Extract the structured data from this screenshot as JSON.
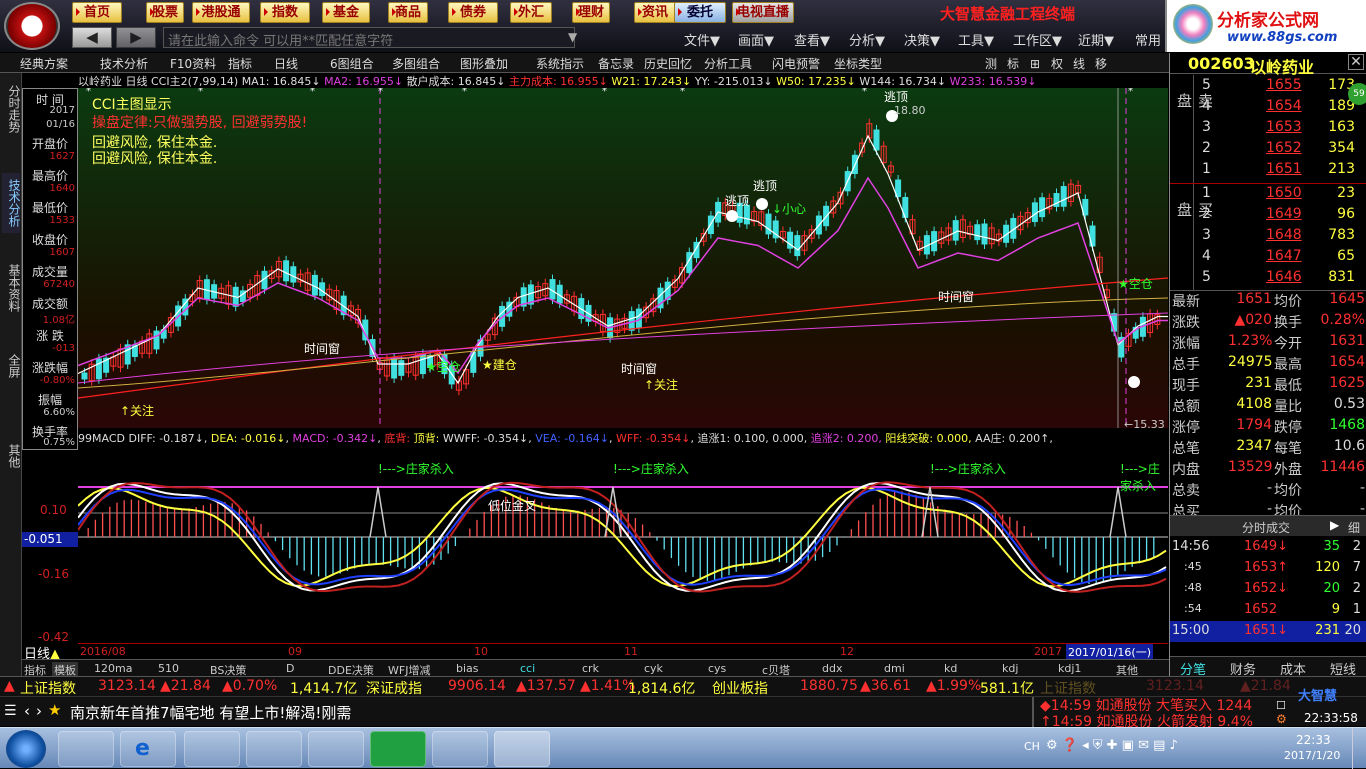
{
  "nav": {
    "buttons": [
      "首页",
      "股票",
      "港股通",
      "指数",
      "基金",
      "商品",
      "债券",
      "外汇",
      "理财",
      "资讯",
      "委托",
      "电视直播"
    ]
  },
  "brand": {
    "title": "大智慧金融工程终端",
    "site_name": "分析家公式网",
    "site_url": "www.88gs.com"
  },
  "command": {
    "placeholder": "请在此输入命令   可以用**匹配任意字符"
  },
  "topmenu": [
    "文件▼",
    "画面▼",
    "查看▼",
    "分析▼",
    "决策▼",
    "工具▼",
    "工作区▼",
    "近期▼",
    "常用"
  ],
  "toolbar": [
    "经典方案",
    "技术分析",
    "F10资料",
    "指标",
    "日线",
    "6图组合",
    "多图组合",
    "图形叠加",
    "系统指示",
    "备忘录",
    "历史回忆",
    "分析工具",
    "闪电预警",
    "坐标类型"
  ],
  "toolbar_right": [
    "测",
    "标",
    "⊞",
    "权",
    "线",
    "移"
  ],
  "left_tabs": [
    "分时走势",
    "技术分析",
    "基本资料",
    "全屏",
    "其他"
  ],
  "info": {
    "labels": [
      "时 间",
      "开盘价",
      "最高价",
      "最低价",
      "收盘价",
      "成交量",
      "成交额",
      "涨 跌",
      "涨跌幅",
      "振幅",
      "换手率"
    ],
    "values": [
      "2017",
      "01/16",
      "1627",
      "1640",
      "1533",
      "1607",
      "67240",
      "1.08亿",
      "-013",
      "-0.80%",
      "6.60%",
      "0.75%"
    ]
  },
  "topline": {
    "stock": "以岭药业",
    "period": "日线",
    "cci": "CCI主2(7,99,14)",
    "ma1": "MA1: 16.845↓",
    "ma2": "MA2: 16.955↓",
    "retail_cost": "散户成本: 16.845↓",
    "main_cost": "主力成本: 16.955↓",
    "w21": "W21: 17.243↓",
    "yy": "YY: -215.013↓",
    "w50": "W50: 17.235↓",
    "w144": "W144: 16.734↓",
    "w233": "W233: 16.539↓"
  },
  "chart_text": {
    "title": "CCI主图显示",
    "motto": "操盘定律:只做强势股, 回避弱势股!",
    "warn1": "回避风险, 保住本金.",
    "warn2": "回避风险, 保住本金.",
    "high_label": "18.80",
    "low_label": "15.33",
    "escape1": "逃顶",
    "escape2": "逃顶",
    "escape3": "逃顶",
    "careful": "↓小心",
    "time_window": "时间窗",
    "empty_pos": "空仓",
    "build_pos": "建仓",
    "watch": "↑关注"
  },
  "macd_line": {
    "name": "99MACD",
    "diff": "DIFF: -0.187↓",
    "dea": "DEA: -0.016↓",
    "macd": "MACD: -0.342↓",
    "div_bottom": "底背:",
    "div_top": "顶背:",
    "wwff": "WWFF: -0.354↓",
    "vea": "VEA: -0.164↓",
    "wff": "WFF: -0.354↓",
    "rise1": "追涨1: 0.100, 0.000,",
    "rise2": "追涨2: 0.200,",
    "yang": "阳线突破: 0.000,",
    "aa": "AA庄: 0.200↑,"
  },
  "macd_text": {
    "kill": "!--->庄家杀入",
    "golden": "低位金叉",
    "y_values": [
      "0.10",
      "-0.051",
      "-0.16",
      "-0.42"
    ]
  },
  "xaxis": [
    "2016/08",
    "09",
    "10",
    "11",
    "12",
    "2017",
    "2017/01/16(一)"
  ],
  "period_label": "日线",
  "bottom_tabs": [
    "指标",
    "模板",
    "120ma",
    "510",
    "BS决策",
    "D",
    "DDE决策",
    "WFJ增减",
    "bias",
    "cci",
    "crk",
    "cyk",
    "cys",
    "c贝塔",
    "ddx",
    "dmi",
    "kd",
    "kdj",
    "kdj1",
    "其他"
  ],
  "right": {
    "code": "002603",
    "name": "以岭药业",
    "sell_label": "卖 盘",
    "buy_label": "买 盘",
    "sell": [
      [
        "5",
        "1655",
        "173"
      ],
      [
        "4",
        "1654",
        "189"
      ],
      [
        "3",
        "1653",
        "163"
      ],
      [
        "2",
        "1652",
        "354"
      ],
      [
        "1",
        "1651",
        "213"
      ]
    ],
    "buy": [
      [
        "1",
        "1650",
        "23"
      ],
      [
        "2",
        "1649",
        "96"
      ],
      [
        "3",
        "1648",
        "783"
      ],
      [
        "4",
        "1647",
        "65"
      ],
      [
        "5",
        "1646",
        "831"
      ]
    ],
    "stats": [
      [
        "最新",
        "1651",
        "均价",
        "1645"
      ],
      [
        "涨跌",
        "▲020",
        "换手",
        "0.28%"
      ],
      [
        "涨幅",
        "1.23%",
        "今开",
        "1631"
      ],
      [
        "总手",
        "24975",
        "最高",
        "1654"
      ],
      [
        "现手",
        "231",
        "最低",
        "1625"
      ],
      [
        "总额",
        "4108",
        "量比",
        "0.53"
      ],
      [
        "涨停",
        "1794",
        "跌停",
        "1468"
      ],
      [
        "总笔",
        "2347",
        "每笔",
        "10.6"
      ],
      [
        "内盘",
        "13529",
        "外盘",
        "11446"
      ],
      [
        "总卖",
        "-",
        "均价",
        "-"
      ],
      [
        "总买",
        "-",
        "均价",
        "-"
      ]
    ],
    "ticks_header": "分时成交",
    "ticks_btn": "细",
    "ticks": [
      [
        "14:56",
        "1649↓",
        "35",
        "2"
      ],
      [
        ":45",
        "1653↑",
        "120",
        "7"
      ],
      [
        ":48",
        "1652↓",
        "20",
        "2"
      ],
      [
        ":54",
        "1652",
        "9",
        "1"
      ],
      [
        "15:00",
        "1651↓",
        "231",
        "20"
      ]
    ],
    "tabs": [
      "分笔",
      "财务",
      "成本",
      "短线"
    ]
  },
  "ticker": {
    "sh_name": "上证指数",
    "sh_val": "3123.14",
    "sh_chg": "▲21.84",
    "sh_pct": "▲0.70%",
    "sh_amt": "1,414.7亿",
    "sz_name": "深证成指",
    "sz_val": "9906.14",
    "sz_chg": "▲137.57",
    "sz_pct": "▲1.41%",
    "sz_amt": "1,814.6亿",
    "cy_name": "创业板指",
    "cy_val": "1880.75",
    "cy_chg": "▲36.61",
    "cy_pct": "▲1.99%",
    "cy_amt": "581.1亿",
    "sh2_name": "上证指数",
    "sh2_val": "3123.14",
    "sh2_chg": "▲21.84"
  },
  "news": {
    "text": "南京新年首推7幅宅地 有望上市!解渴!刚需",
    "alert1": "14:59 如通股份 大笔买入 1244",
    "alert2": "14:59 如通股份 火箭发射 9.4%",
    "logo": "大智慧",
    "time": "22:33:58"
  },
  "taskbar": {
    "lang": "CH",
    "clock_time": "22:33",
    "clock_date": "2017/1/20"
  },
  "colors": {
    "up": "#ff3030",
    "down": "#40e0e0",
    "yellow": "#ffff40",
    "magenta": "#e040e0",
    "white": "#ffffff",
    "gold": "#d0b040"
  }
}
